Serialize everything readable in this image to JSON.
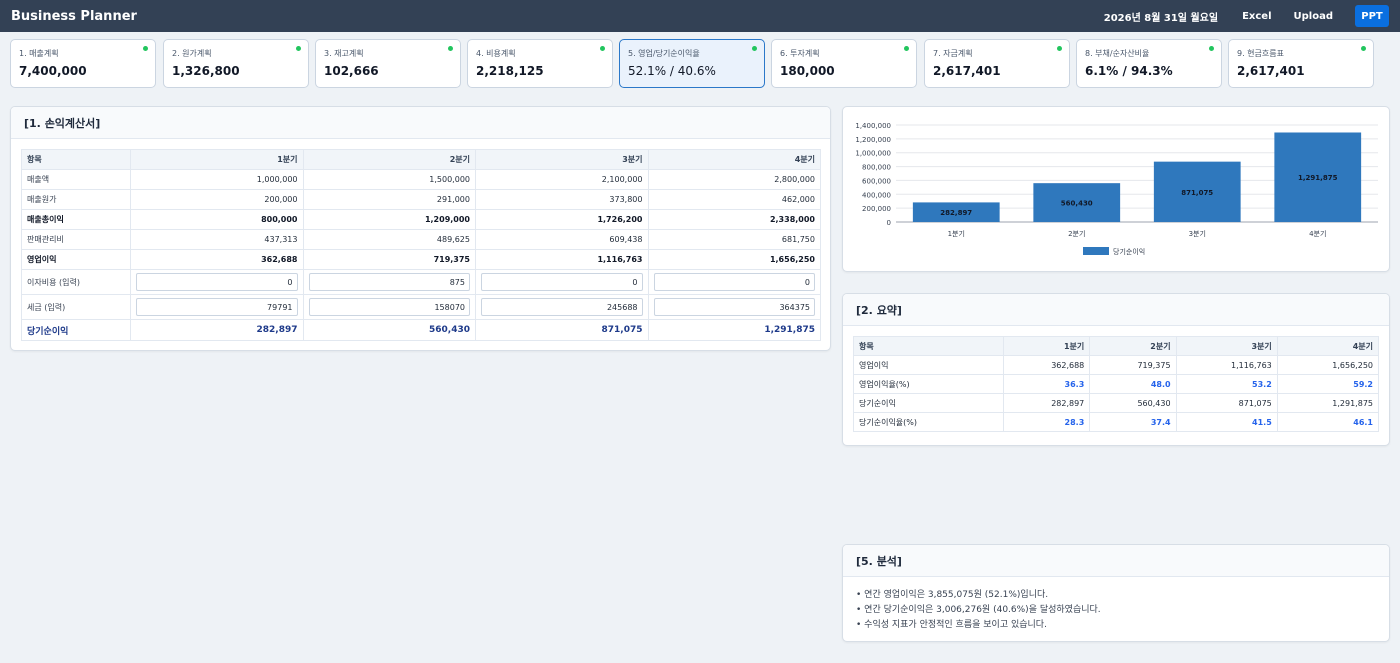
{
  "header": {
    "title": "Business Planner",
    "date": "2026년 8월 31일 월요일",
    "excel_label": "Excel",
    "upload_label": "Upload",
    "ppt_label": "PPT"
  },
  "cards": [
    {
      "label": "1. 매출계획",
      "value": "7,400,000",
      "active": false
    },
    {
      "label": "2. 원가계획",
      "value": "1,326,800",
      "active": false
    },
    {
      "label": "3. 재고계획",
      "value": "102,666",
      "active": false
    },
    {
      "label": "4. 비용계획",
      "value": "2,218,125",
      "active": false
    },
    {
      "label": "5. 영업/당기순이익율",
      "value": "52.1% / 40.6%",
      "active": true
    },
    {
      "label": "6. 투자계획",
      "value": "180,000",
      "active": false
    },
    {
      "label": "7. 자금계획",
      "value": "2,617,401",
      "active": false
    },
    {
      "label": "8. 부채/순자산비율",
      "value": "6.1% / 94.3%",
      "active": false
    },
    {
      "label": "9. 현금흐름표",
      "value": "2,617,401",
      "active": false
    }
  ],
  "colors": {
    "accent": "#0a6fe0",
    "status_dot": "#22c55e",
    "bar": "#2f78bd",
    "net_income": "#1e3a8a",
    "highlight_blue": "#2563eb"
  },
  "income_statement": {
    "title": "[1. 손익계산서]",
    "headers": [
      "항목",
      "1분기",
      "2분기",
      "3분기",
      "4분기"
    ],
    "rows": {
      "revenue": {
        "label": "매출액",
        "values": [
          "1,000,000",
          "1,500,000",
          "2,100,000",
          "2,800,000"
        ]
      },
      "cogs": {
        "label": "매출원가",
        "values": [
          "200,000",
          "291,000",
          "373,800",
          "462,000"
        ]
      },
      "gross_profit": {
        "label": "매출총이익",
        "values": [
          "800,000",
          "1,209,000",
          "1,726,200",
          "2,338,000"
        ]
      },
      "sga": {
        "label": "판매관리비",
        "values": [
          "437,313",
          "489,625",
          "609,438",
          "681,750"
        ]
      },
      "operating_income": {
        "label": "영업이익",
        "values": [
          "362,688",
          "719,375",
          "1,116,763",
          "1,656,250"
        ]
      },
      "interest": {
        "label": "이자비용 (입력)",
        "values": [
          "0",
          "875",
          "0",
          "0"
        ]
      },
      "tax": {
        "label": "세금 (입력)",
        "values": [
          "79791",
          "158070",
          "245688",
          "364375"
        ]
      },
      "net_income": {
        "label": "당기순이익",
        "values": [
          "282,897",
          "560,430",
          "871,075",
          "1,291,875"
        ]
      }
    }
  },
  "chart_data": {
    "type": "bar",
    "categories": [
      "1분기",
      "2분기",
      "3분기",
      "4분기"
    ],
    "series": [
      {
        "name": "당기순이익",
        "values": [
          282897,
          560430,
          871075,
          1291875
        ]
      }
    ],
    "data_labels": [
      "282,897",
      "560,430",
      "871,075",
      "1,291,875"
    ],
    "ylim": [
      0,
      1400000
    ],
    "yticks": [
      0,
      200000,
      400000,
      600000,
      800000,
      1000000,
      1200000,
      1400000
    ],
    "ytick_labels": [
      "0",
      "200,000",
      "400,000",
      "600,000",
      "800,000",
      "1,000,000",
      "1,200,000",
      "1,400,000"
    ],
    "grid": true,
    "legend": "bottom",
    "title": "",
    "xlabel": "",
    "ylabel": ""
  },
  "summary": {
    "title": "[2. 요약]",
    "headers": [
      "항목",
      "1분기",
      "2분기",
      "3분기",
      "4분기"
    ],
    "rows": [
      {
        "label": "영업이익",
        "values": [
          "362,688",
          "719,375",
          "1,116,763",
          "1,656,250"
        ],
        "highlight": false
      },
      {
        "label": "영업이익율(%)",
        "values": [
          "36.3",
          "48.0",
          "53.2",
          "59.2"
        ],
        "highlight": true
      },
      {
        "label": "당기순이익",
        "values": [
          "282,897",
          "560,430",
          "871,075",
          "1,291,875"
        ],
        "highlight": false
      },
      {
        "label": "당기순이익율(%)",
        "values": [
          "28.3",
          "37.4",
          "41.5",
          "46.1"
        ],
        "highlight": true
      }
    ]
  },
  "analysis": {
    "title": "[5. 분석]",
    "lines": [
      "• 연간 영업이익은 3,855,075원 (52.1%)입니다.",
      "• 연간 당기순이익은 3,006,276원 (40.6%)을 달성하였습니다.",
      "• 수익성 지표가 안정적인 흐름을 보이고 있습니다."
    ]
  }
}
